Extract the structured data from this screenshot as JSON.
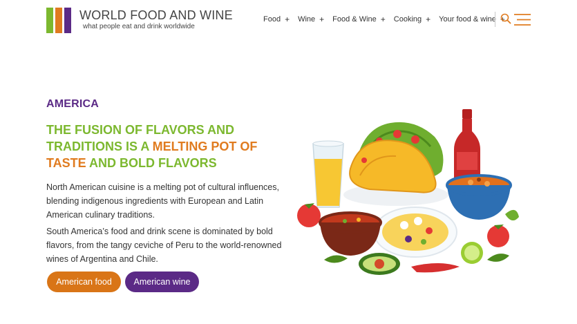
{
  "brand": {
    "title": "WORLD FOOD AND WINE",
    "tagline": "what people eat and drink worldwide",
    "bar_colors": [
      "#7cb82f",
      "#e07b1f",
      "#5b2a86"
    ]
  },
  "nav": {
    "items": [
      {
        "label": "Food",
        "plus": "+"
      },
      {
        "label": "Wine",
        "plus": "+"
      },
      {
        "label": "Food & Wine",
        "plus": "+"
      },
      {
        "label": "Cooking",
        "plus": "+"
      },
      {
        "label": "Your food & wine",
        "plus": "+"
      }
    ],
    "icons": {
      "search": "search-icon",
      "menu": "hamburger-menu-icon"
    }
  },
  "hero": {
    "kicker": "AMERICA",
    "headline": {
      "part1": "THE FUSION OF FLAVORS AND TRADITIONS IS A ",
      "part2": "MELTING POT OF TASTE",
      "part3": " AND BOLD FLAVORS"
    },
    "paragraphs": [
      "North American cuisine is a melting pot of cultural influences, blending indigenous ingredients with European and Latin American culinary traditions.",
      "South America’s food and drink scene is dominated by bold flavors, from the tangy ceviche of Peru to the world-renowned wines of Argentina and Chile."
    ],
    "buttons": [
      {
        "label": "American food",
        "color": "#d97517"
      },
      {
        "label": "American wine",
        "color": "#5b2a86"
      }
    ]
  },
  "colors": {
    "accent_green": "#7cb82f",
    "accent_orange": "#e07b1f",
    "accent_purple": "#5b2a86"
  }
}
